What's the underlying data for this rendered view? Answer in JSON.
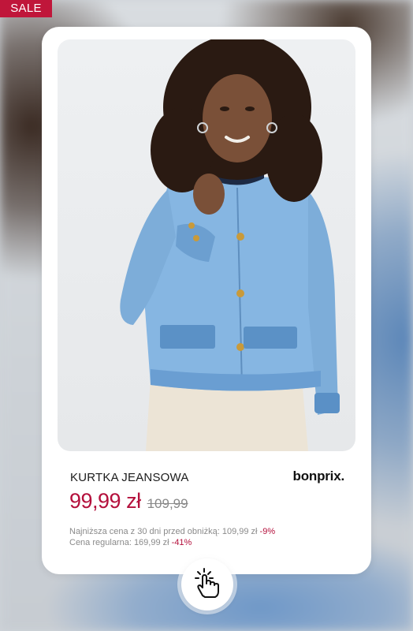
{
  "badge": {
    "label": "SALE"
  },
  "product": {
    "name": "KURTKA JEANSOWA",
    "brand": "bonprix.",
    "price_current": "99,99 zł",
    "price_old": "109,99",
    "lowest_price_label": "Najniższa cena z 30 dni przed obniżką: 109,99 zł",
    "lowest_price_discount": "-9%",
    "regular_price_label": "Cena regularna: 169,99 zł",
    "regular_price_discount": "-41%"
  },
  "icons": {
    "tap": "hand-tap-icon",
    "photo": "product-photo"
  },
  "colors": {
    "sale": "#c0163a",
    "price": "#b4103c",
    "card": "#ffffff",
    "denim": "#7fb0e0"
  }
}
